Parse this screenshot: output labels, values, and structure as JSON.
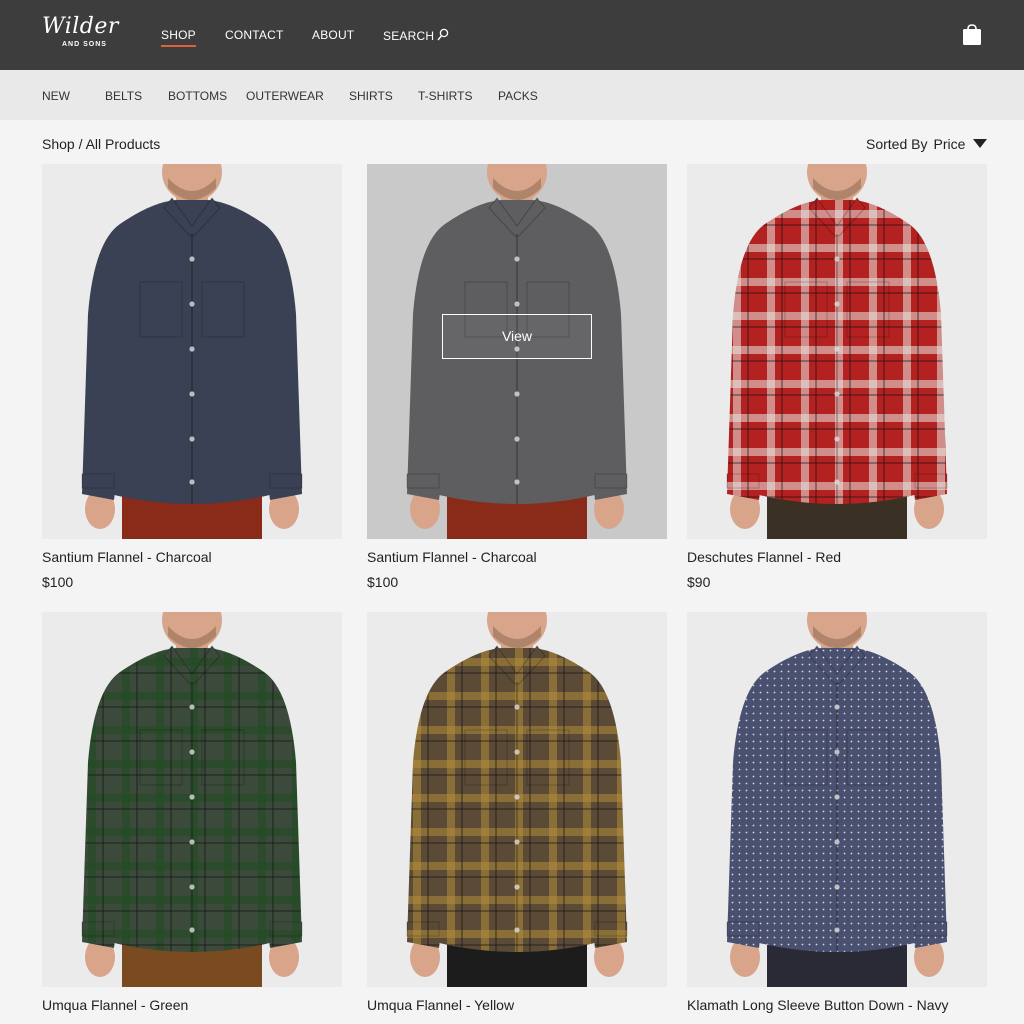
{
  "header": {
    "logo_script": "Wilder",
    "logo_sub": "AND SONS",
    "nav": [
      "SHOP",
      "CONTACT",
      "ABOUT",
      "SEARCH"
    ],
    "active": "SHOP"
  },
  "categories": [
    "NEW",
    "BELTS",
    "BOTTOMS",
    "OUTERWEAR",
    "SHIRTS",
    "T-SHIRTS",
    "PACKS"
  ],
  "breadcrumb": "Shop / All Products",
  "sort": {
    "label": "Sorted By",
    "value": "Price"
  },
  "products": [
    {
      "name": "Santium Flannel - Charcoal",
      "price": "$100",
      "shirt": "#3a4154",
      "pattern": "solid",
      "pants": "#8a2a18",
      "accent": "#3a4154"
    },
    {
      "name": "Santium Flannel - Charcoal",
      "price": "$100",
      "shirt": "#5e5e60",
      "pattern": "solid",
      "pants": "#8a2a18",
      "accent": "#5e5e60",
      "hover_label": "View"
    },
    {
      "name": "Deschutes Flannel - Red",
      "price": "$90",
      "shirt": "#b32121",
      "pattern": "plaid",
      "pants": "#3a3024",
      "accent": "#e9e5e0"
    },
    {
      "name": "Umqua Flannel - Green",
      "price": "",
      "shirt": "#3b4a3a",
      "pattern": "plaid",
      "pants": "#7a4a20",
      "accent": "#1f4d22"
    },
    {
      "name": "Umqua Flannel - Yellow",
      "price": "",
      "shirt": "#5a4a36",
      "pattern": "plaid",
      "pants": "#1c1c1c",
      "accent": "#b08c3a"
    },
    {
      "name": "Klamath Long Sleeve Button Down - Navy",
      "price": "",
      "shirt": "#4a5070",
      "pattern": "dots",
      "pants": "#2a2a36",
      "accent": "#d8d8e4"
    }
  ]
}
